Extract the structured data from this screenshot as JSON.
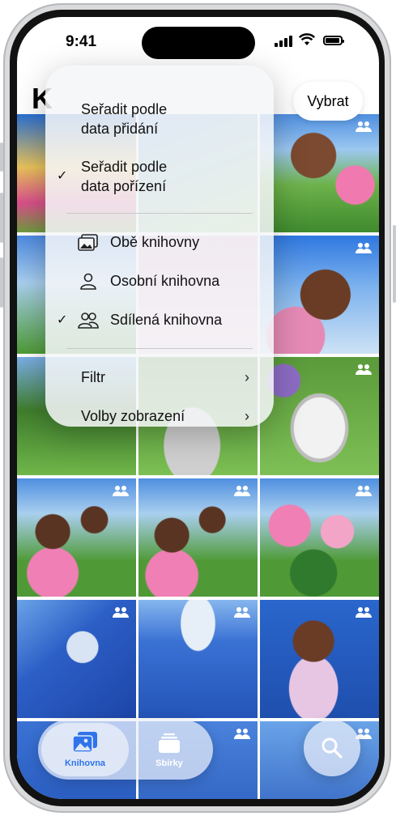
{
  "status": {
    "time": "9:41"
  },
  "header": {
    "title": "K",
    "select_label": "Vybrat"
  },
  "menu": {
    "sort_added": {
      "line1": "Seřadit podle",
      "line2": "data přidání"
    },
    "sort_captured": {
      "line1": "Seřadit podle",
      "line2": "data pořízení",
      "checked": true
    },
    "both_libraries": "Obě knihovny",
    "personal_library": "Osobní knihovna",
    "shared_library": "Sdílená knihovna",
    "filter": "Filtr",
    "view_options": "Volby zobrazení",
    "check_glyph": "✓",
    "chevron_glyph": "›"
  },
  "tabs": [
    {
      "label": "Knihovna",
      "icon": "photo-library-icon",
      "active": true
    },
    {
      "label": "Sbírky",
      "icon": "collections-icon",
      "active": false
    }
  ],
  "colors": {
    "accent": "#2f74ea",
    "menu_bg": "#f5f6f8"
  }
}
